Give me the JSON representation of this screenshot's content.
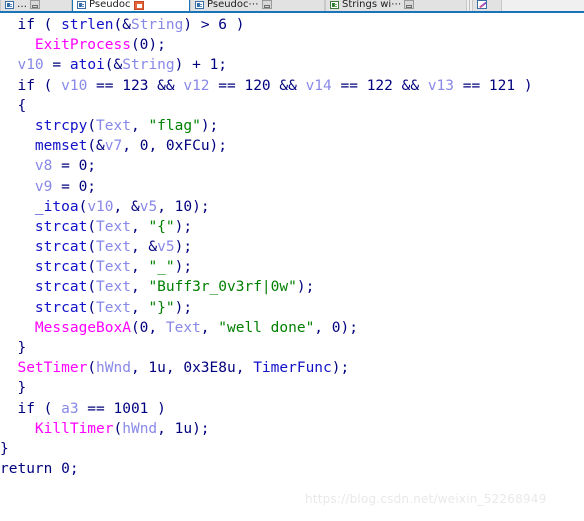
{
  "window": {
    "app": "IDA Pro pseudocode view",
    "accent_color": "#1a74b8"
  },
  "tabbar": {
    "tabs": [
      {
        "label": "…",
        "icon": "document-icon",
        "active": false,
        "close_label": "restore-button"
      },
      {
        "label": "Pseudoc",
        "icon": "document-icon",
        "active": true,
        "close_label": "close-button"
      },
      {
        "label": "Pseudoc⋯",
        "icon": "document-icon",
        "active": false,
        "close_label": "restore-button"
      },
      {
        "label": "Strings wi⋯",
        "icon": "strings-icon",
        "active": false,
        "close_label": "restore-button"
      },
      {
        "label": "",
        "icon": "pencil-icon",
        "active": false,
        "close_label": ""
      }
    ]
  },
  "code": {
    "language": "c",
    "lines": [
      [
        {
          "t": "  if ( ",
          "c": "kw"
        },
        {
          "t": "strlen",
          "c": "fn"
        },
        {
          "t": "(&",
          "c": "kw"
        },
        {
          "t": "String",
          "c": "var"
        },
        {
          "t": ") > 6 )",
          "c": "kw"
        }
      ],
      [
        {
          "t": "    ",
          "c": "kw"
        },
        {
          "t": "ExitProcess",
          "c": "api"
        },
        {
          "t": "(0);",
          "c": "kw"
        }
      ],
      [
        {
          "t": "  ",
          "c": "kw"
        },
        {
          "t": "v10",
          "c": "var"
        },
        {
          "t": " = ",
          "c": "kw"
        },
        {
          "t": "atoi",
          "c": "fn"
        },
        {
          "t": "(&",
          "c": "kw"
        },
        {
          "t": "String",
          "c": "var"
        },
        {
          "t": ") + 1;",
          "c": "kw"
        }
      ],
      [
        {
          "t": "  if ( ",
          "c": "kw"
        },
        {
          "t": "v10",
          "c": "var"
        },
        {
          "t": " == 123 && ",
          "c": "kw"
        },
        {
          "t": "v12",
          "c": "var"
        },
        {
          "t": " == 120 && ",
          "c": "kw"
        },
        {
          "t": "v14",
          "c": "var"
        },
        {
          "t": " == 122 && ",
          "c": "kw"
        },
        {
          "t": "v13",
          "c": "var"
        },
        {
          "t": " == 121 )",
          "c": "kw"
        }
      ],
      [
        {
          "t": "  {",
          "c": "kw"
        }
      ],
      [
        {
          "t": "    ",
          "c": "kw"
        },
        {
          "t": "strcpy",
          "c": "fn"
        },
        {
          "t": "(",
          "c": "kw"
        },
        {
          "t": "Text",
          "c": "var"
        },
        {
          "t": ", ",
          "c": "kw"
        },
        {
          "t": "\"flag\"",
          "c": "str"
        },
        {
          "t": ");",
          "c": "kw"
        }
      ],
      [
        {
          "t": "    ",
          "c": "kw"
        },
        {
          "t": "memset",
          "c": "fn"
        },
        {
          "t": "(&",
          "c": "kw"
        },
        {
          "t": "v7",
          "c": "var"
        },
        {
          "t": ", 0, 0xFCu);",
          "c": "kw"
        }
      ],
      [
        {
          "t": "    ",
          "c": "kw"
        },
        {
          "t": "v8",
          "c": "var"
        },
        {
          "t": " = 0;",
          "c": "kw"
        }
      ],
      [
        {
          "t": "    ",
          "c": "kw"
        },
        {
          "t": "v9",
          "c": "var"
        },
        {
          "t": " = 0;",
          "c": "kw"
        }
      ],
      [
        {
          "t": "    ",
          "c": "kw"
        },
        {
          "t": "_itoa",
          "c": "fn"
        },
        {
          "t": "(",
          "c": "kw"
        },
        {
          "t": "v10",
          "c": "var"
        },
        {
          "t": ", &",
          "c": "kw"
        },
        {
          "t": "v5",
          "c": "var"
        },
        {
          "t": ", 10);",
          "c": "kw"
        }
      ],
      [
        {
          "t": "    ",
          "c": "kw"
        },
        {
          "t": "strcat",
          "c": "fn"
        },
        {
          "t": "(",
          "c": "kw"
        },
        {
          "t": "Text",
          "c": "var"
        },
        {
          "t": ", ",
          "c": "kw"
        },
        {
          "t": "\"{\"",
          "c": "str"
        },
        {
          "t": ");",
          "c": "kw"
        }
      ],
      [
        {
          "t": "    ",
          "c": "kw"
        },
        {
          "t": "strcat",
          "c": "fn"
        },
        {
          "t": "(",
          "c": "kw"
        },
        {
          "t": "Text",
          "c": "var"
        },
        {
          "t": ", &",
          "c": "kw"
        },
        {
          "t": "v5",
          "c": "var"
        },
        {
          "t": ");",
          "c": "kw"
        }
      ],
      [
        {
          "t": "    ",
          "c": "kw"
        },
        {
          "t": "strcat",
          "c": "fn"
        },
        {
          "t": "(",
          "c": "kw"
        },
        {
          "t": "Text",
          "c": "var"
        },
        {
          "t": ", ",
          "c": "kw"
        },
        {
          "t": "\"_\"",
          "c": "str"
        },
        {
          "t": ");",
          "c": "kw"
        }
      ],
      [
        {
          "t": "    ",
          "c": "kw"
        },
        {
          "t": "strcat",
          "c": "fn"
        },
        {
          "t": "(",
          "c": "kw"
        },
        {
          "t": "Text",
          "c": "var"
        },
        {
          "t": ", ",
          "c": "kw"
        },
        {
          "t": "\"Buff3r_0v3rf|0w\"",
          "c": "str"
        },
        {
          "t": ");",
          "c": "kw"
        }
      ],
      [
        {
          "t": "    ",
          "c": "kw"
        },
        {
          "t": "strcat",
          "c": "fn"
        },
        {
          "t": "(",
          "c": "kw"
        },
        {
          "t": "Text",
          "c": "var"
        },
        {
          "t": ", ",
          "c": "kw"
        },
        {
          "t": "\"}\"",
          "c": "str"
        },
        {
          "t": ");",
          "c": "kw"
        }
      ],
      [
        {
          "t": "    ",
          "c": "kw"
        },
        {
          "t": "MessageBoxA",
          "c": "api"
        },
        {
          "t": "(0, ",
          "c": "kw"
        },
        {
          "t": "Text",
          "c": "var"
        },
        {
          "t": ", ",
          "c": "kw"
        },
        {
          "t": "\"well done\"",
          "c": "str"
        },
        {
          "t": ", 0);",
          "c": "kw"
        }
      ],
      [
        {
          "t": "  }",
          "c": "kw"
        }
      ],
      [
        {
          "t": "  ",
          "c": "kw"
        },
        {
          "t": "SetTimer",
          "c": "api"
        },
        {
          "t": "(",
          "c": "kw"
        },
        {
          "t": "hWnd",
          "c": "var"
        },
        {
          "t": ", 1u, 0x3E8u, ",
          "c": "kw"
        },
        {
          "t": "TimerFunc",
          "c": "fn"
        },
        {
          "t": ");",
          "c": "kw"
        }
      ],
      [
        {
          "t": "  }",
          "c": "kw"
        }
      ],
      [
        {
          "t": "  if ( ",
          "c": "kw"
        },
        {
          "t": "a3",
          "c": "var"
        },
        {
          "t": " == 1001 )",
          "c": "kw"
        }
      ],
      [
        {
          "t": "    ",
          "c": "kw"
        },
        {
          "t": "KillTimer",
          "c": "api"
        },
        {
          "t": "(",
          "c": "kw"
        },
        {
          "t": "hWnd",
          "c": "var"
        },
        {
          "t": ", 1u);",
          "c": "kw"
        }
      ],
      [
        {
          "t": "}",
          "c": "kw"
        }
      ],
      [
        {
          "t": "return 0;",
          "c": "kw"
        }
      ]
    ]
  },
  "watermark": {
    "text": "https://blog.csdn.net/weixin_52268949"
  }
}
